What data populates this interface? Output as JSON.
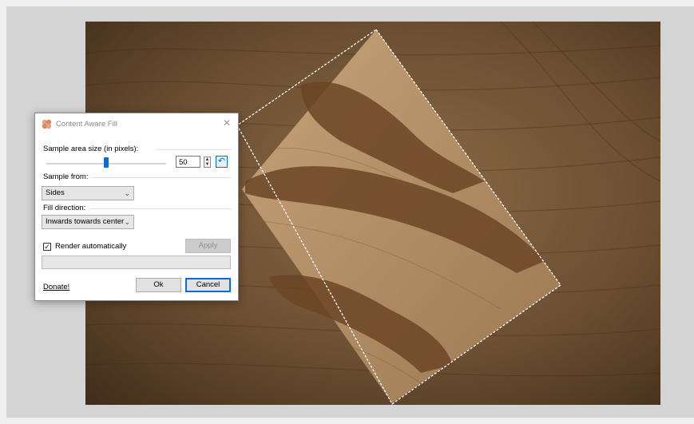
{
  "dialog": {
    "title": "Content Aware Fill",
    "close_glyph": "✕",
    "sample_area_label": "Sample area size (in pixels):",
    "sample_area_value": "50",
    "slider_fraction": 0.5,
    "reset_glyph": "↶",
    "sample_from_label": "Sample from:",
    "sample_from_value": "Sides",
    "fill_direction_label": "Fill direction:",
    "fill_direction_value": "Inwards towards center",
    "render_auto_label": "Render automatically",
    "render_auto_checked": true,
    "apply_label": "Apply",
    "progress_fraction": 0,
    "donate_label": "Donate!",
    "ok_label": "Ok",
    "cancel_label": "Cancel"
  },
  "icons": {
    "app": "content-aware-fill-icon",
    "close": "close-icon",
    "reset": "reset-icon",
    "dropdown": "chevron-down-icon",
    "check": "checkmark-icon"
  },
  "colors": {
    "accent": "#0a6cd6",
    "wood_dark": "#4a3320",
    "wood_light": "#b7926a",
    "workspace": "#d4d4d4"
  }
}
